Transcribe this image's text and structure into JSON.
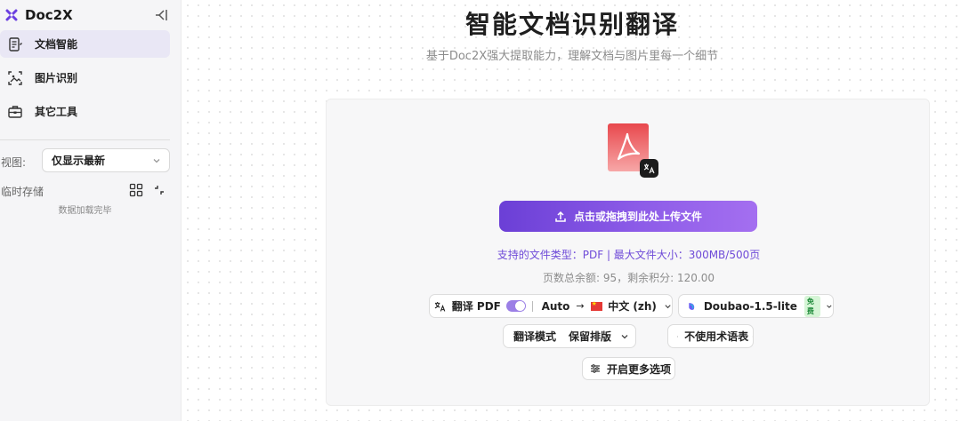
{
  "app": {
    "name": "Doc2X"
  },
  "sidebar": {
    "items": [
      {
        "label": "文档智能",
        "icon": "doc-edit-icon",
        "active": true
      },
      {
        "label": "图片识别",
        "icon": "image-scan-icon",
        "active": false
      },
      {
        "label": "其它工具",
        "icon": "toolbox-icon",
        "active": false
      }
    ],
    "view_label": "视图:",
    "view_value": "仅显示最新",
    "storage_label": "临时存储",
    "storage_empty": "数据加载完毕"
  },
  "main": {
    "title": "智能文档识别翻译",
    "subtitle": "基于Doc2X强大提取能力，理解文档与图片里每一个细节",
    "upload_label": "点击或拖拽到此处上传文件",
    "support_text": "支持的文件类型：PDF  |  最大文件大小：300MB/500页",
    "quota_text": "页数总余额: 95，剩余积分: 120.00",
    "translate_label": "翻译 PDF",
    "translate_on": true,
    "source_lang": "Auto",
    "target_lang": "中文 (zh)",
    "model_name": "Doubao-1.5-lite",
    "model_badge": "免费",
    "mode_label": "翻译模式",
    "mode_value": "保留排版",
    "glossary_label": "不使用术语表",
    "more_options_label": "开启更多选项"
  },
  "colors": {
    "accent": "#7b4fe0",
    "active_nav": "#e9e7f5",
    "pdf_red": "#e8484d"
  }
}
